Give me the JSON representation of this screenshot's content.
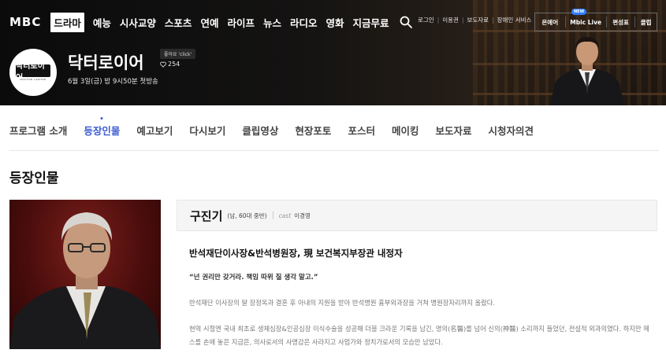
{
  "brand": {
    "logo": "MBC"
  },
  "main_nav": [
    "드라마",
    "예능",
    "시사교양",
    "스포츠",
    "연예",
    "라이프",
    "뉴스",
    "라디오",
    "영화",
    "지금무료"
  ],
  "active_main_nav": "드라마",
  "utility_nav": [
    "로그인",
    "이용권",
    "보도자료",
    "장애인 서비스"
  ],
  "services": {
    "onair": "온에어",
    "mbclive": "Mbic Live",
    "new_badge": "NEW",
    "schedule": "편성표",
    "club": "클럽"
  },
  "program": {
    "logo_text": "닥터로이어",
    "logo_sub": "DOCTOR LAWYER",
    "title": "닥터로이어",
    "airtime": "6월 3일(금) 밤 9시50분 첫방송",
    "like_tooltip": "좋아요 'click'",
    "like_count": "254"
  },
  "tabs": [
    "프로그램 소개",
    "등장인물",
    "예고보기",
    "다시보기",
    "클립영상",
    "현장포토",
    "포스터",
    "메이킹",
    "보도자료",
    "시청자의견"
  ],
  "active_tab": "등장인물",
  "section": {
    "title": "등장인물"
  },
  "character": {
    "name": "구진기",
    "info": "(남, 60대 중반)",
    "cast_label": "cast",
    "cast_name": "이경영",
    "role": "반석재단이사장&반석병원장, 現 보건복지부장관 내정자",
    "quote": "“넌 권리만 갖거라. 책임 따위 질 생각 말고.”",
    "desc1": "반석재단 이사장의 딸 장정옥과 결혼 후 아내의 지원을 받아 반석병원 흉부외과장을 거쳐 병원장자리까지 올랐다.",
    "desc2": "현역 시절엔 국내 최초로 생체심장&인공심장 이식수술을 성공해 더블 크라운 기록을 남긴, 명의(名醫)를 넘어 신의(神醫) 소리까지 들었던, 전설적 외과의였다. 하지만 메스를 손에 놓은 지금은, 의사로서의 사명감은 사라지고 사업가와 정치가로서의 모습만 남았다."
  }
}
